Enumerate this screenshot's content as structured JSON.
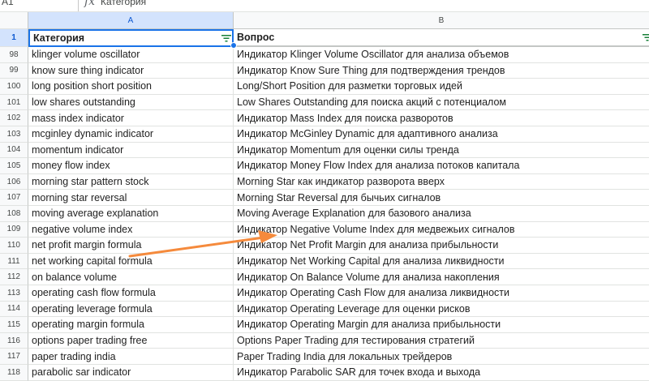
{
  "formula_bar": {
    "cell_ref": "A1",
    "fx": "fx",
    "content": "Категория"
  },
  "columns": [
    "A",
    "B"
  ],
  "header_row": {
    "num": "1",
    "a": "Категория",
    "b": "Вопрос"
  },
  "rows": [
    {
      "num": "98",
      "a": "klinger volume oscillator",
      "b": "Индикатор Klinger Volume Oscillator для анализа объемов"
    },
    {
      "num": "99",
      "a": "know sure thing indicator",
      "b": "Индикатор Know Sure Thing для подтверждения трендов"
    },
    {
      "num": "100",
      "a": "long position short position",
      "b": "Long/Short Position для разметки торговых идей"
    },
    {
      "num": "101",
      "a": "low shares outstanding",
      "b": "Low Shares Outstanding для поиска акций с потенциалом"
    },
    {
      "num": "102",
      "a": "mass index indicator",
      "b": "Индикатор Mass Index для поиска разворотов"
    },
    {
      "num": "103",
      "a": "mcginley dynamic indicator",
      "b": "Индикатор McGinley Dynamic для адаптивного анализа"
    },
    {
      "num": "104",
      "a": "momentum indicator",
      "b": "Индикатор Momentum для оценки силы тренда"
    },
    {
      "num": "105",
      "a": "money flow index",
      "b": "Индикатор Money Flow Index для анализа потоков капитала"
    },
    {
      "num": "106",
      "a": "morning star pattern stock",
      "b": "Morning Star как индикатор разворота вверх"
    },
    {
      "num": "107",
      "a": "morning star reversal",
      "b": "Morning Star Reversal для бычьих сигналов"
    },
    {
      "num": "108",
      "a": "moving average explanation",
      "b": "Moving Average Explanation для базового анализа"
    },
    {
      "num": "109",
      "a": "negative volume index",
      "b": "Индикатор Negative Volume Index для медвежьих сигналов"
    },
    {
      "num": "110",
      "a": "net profit margin formula",
      "b": "Индикатор Net Profit Margin для анализа прибыльности"
    },
    {
      "num": "111",
      "a": "net working capital formula",
      "b": "Индикатор Net Working Capital для анализа ликвидности"
    },
    {
      "num": "112",
      "a": "on balance volume",
      "b": "Индикатор On Balance Volume для анализа накопления"
    },
    {
      "num": "113",
      "a": "operating cash flow formula",
      "b": "Индикатор Operating Cash Flow для анализа ликвидности"
    },
    {
      "num": "114",
      "a": "operating leverage formula",
      "b": "Индикатор Operating Leverage для оценки рисков"
    },
    {
      "num": "115",
      "a": "operating margin formula",
      "b": "Индикатор Operating Margin для анализа прибыльности"
    },
    {
      "num": "116",
      "a": "options paper trading free",
      "b": "Options Paper Trading для тестирования стратегий"
    },
    {
      "num": "117",
      "a": "paper trading india",
      "b": "Paper Trading India для локальных трейдеров"
    },
    {
      "num": "118",
      "a": "parabolic sar indicator",
      "b": "Индикатор Parabolic SAR для точек входа и выхода"
    }
  ],
  "colors": {
    "selection": "#1a73e8",
    "annotation_arrow": "#f58a3c",
    "header_bg": "#f8f9fa"
  }
}
